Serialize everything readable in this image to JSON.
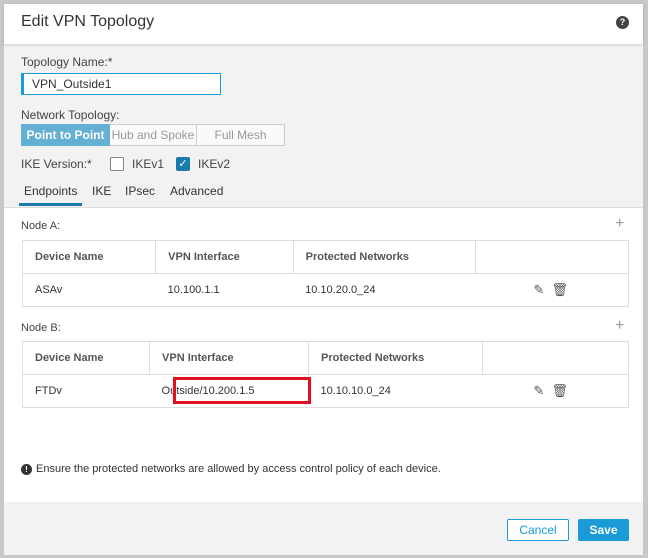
{
  "dialog": {
    "title": "Edit VPN Topology",
    "help_icon": "?"
  },
  "topology_name": {
    "label": "Topology Name:*",
    "value": "VPN_Outside1"
  },
  "network_topology": {
    "label": "Network Topology:",
    "options": [
      "Point to Point",
      "Hub and Spoke",
      "Full Mesh"
    ],
    "selected": "Point to Point"
  },
  "ike": {
    "label": "IKE Version:*",
    "v1": {
      "label": "IKEv1",
      "checked": false
    },
    "v2": {
      "label": "IKEv2",
      "checked": true,
      "check": "✓"
    }
  },
  "tabs": [
    "Endpoints",
    "IKE",
    "IPsec",
    "Advanced"
  ],
  "columns": [
    "Device Name",
    "VPN Interface",
    "Protected Networks"
  ],
  "node_a": {
    "label": "Node A:",
    "add": "+",
    "row": {
      "device": "ASAv",
      "interface": "10.100.1.1",
      "networks": "10.10.20.0_24"
    }
  },
  "node_b": {
    "label": "Node B:",
    "add": "+",
    "row": {
      "device": "FTDv",
      "interface": "Outside/10.200.1.5",
      "networks": "10.10.10.0_24"
    }
  },
  "note": {
    "icon": "!",
    "text": "Ensure the protected networks are allowed by access control policy of each device."
  },
  "footer": {
    "cancel": "Cancel",
    "save": "Save"
  },
  "colors": {
    "accent": "#1a9ad6",
    "highlight": "#e0101e"
  }
}
